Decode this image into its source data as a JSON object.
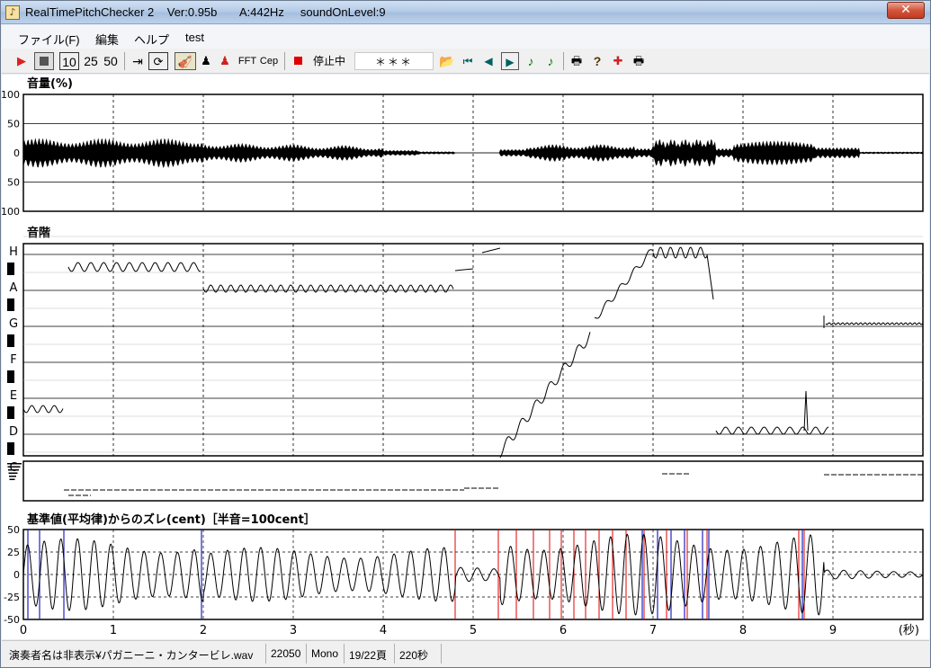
{
  "window": {
    "title": "RealTimePitchChecker 2    Ver:0.95b       A:442Hz     soundOnLevel:9",
    "close_glyph": "✕"
  },
  "menu": [
    "ファイル(F)",
    "編集",
    "ヘルプ",
    "test"
  ],
  "toolbar": {
    "speed_options": [
      "10",
      "25",
      "50"
    ],
    "fft_label": "FFT",
    "cep_label": "Cep",
    "status": "停止中",
    "stars": "＊＊＊"
  },
  "volume_panel": {
    "title": "音量(%)",
    "y_labels": [
      "100",
      "50",
      "0",
      "50",
      "100"
    ]
  },
  "scale_panel": {
    "title": "音階",
    "notes": [
      "H",
      "A",
      "G",
      "F",
      "E",
      "D",
      "C"
    ]
  },
  "deviation_panel": {
    "title": "基準値(平均律)からのズレ(cent)［半音=100cent］",
    "y_labels": [
      "50",
      "25",
      "0",
      "-25",
      "-50"
    ]
  },
  "time_axis": {
    "labels": [
      "0",
      "1",
      "2",
      "3",
      "4",
      "5",
      "6",
      "7",
      "8",
      "9"
    ],
    "unit": "(秒)"
  },
  "status_bar": {
    "file": "演奏者名は非表示¥パガニーニ・カンタービレ.wav",
    "rate": "22050",
    "channels": "Mono",
    "page": "19/22頁",
    "length": "220秒"
  },
  "colors": {
    "signal": "#000000",
    "red_marker": "#e00000",
    "blue_marker": "#2020c0",
    "play_icon": "#e02020"
  }
}
